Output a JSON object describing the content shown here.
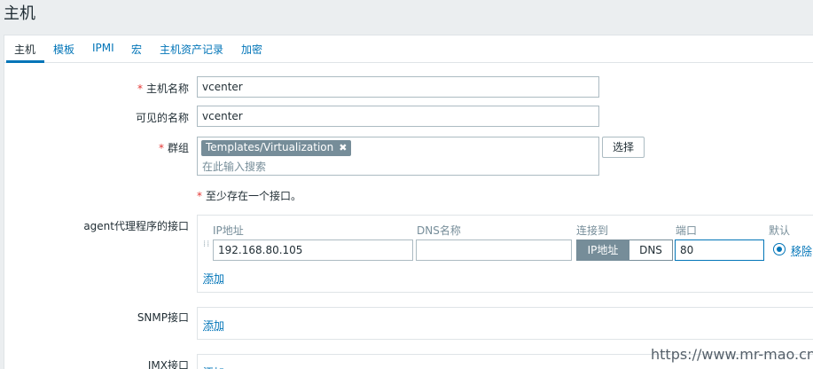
{
  "header": {
    "title": "主机"
  },
  "tabs": [
    {
      "label": "主机"
    },
    {
      "label": "模板"
    },
    {
      "label": "IPMI"
    },
    {
      "label": "宏"
    },
    {
      "label": "主机资产记录"
    },
    {
      "label": "加密"
    }
  ],
  "form": {
    "required_mark": "*",
    "host_name": {
      "label": "主机名称",
      "value": "vcenter"
    },
    "visible_name": {
      "label": "可见的名称",
      "value": "vcenter"
    },
    "groups": {
      "label": "群组",
      "chip": "Templates/Virtualization",
      "chip_close": "✖",
      "placeholder": "在此输入搜索",
      "select_button": "选择"
    },
    "interface_note": "至少存在一个接口。",
    "agent": {
      "label": "agent代理程序的接口",
      "headers": {
        "ip": "IP地址",
        "dns": "DNS名称",
        "connect": "连接到",
        "port": "端口",
        "default": "默认"
      },
      "ip_value": "192.168.80.105",
      "dns_value": "",
      "connect_ip": "IP地址",
      "connect_dns": "DNS",
      "port_value": "80",
      "remove": "移除",
      "add": "添加"
    },
    "snmp": {
      "label": "SNMP接口",
      "add": "添加"
    },
    "jmx": {
      "label": "JMX接口",
      "add": "添加"
    }
  },
  "watermark": "https://www.mr-mao.cn",
  "colors": {
    "accent": "#0275b8",
    "required": "#e33734",
    "chip_bg": "#768d99",
    "bg": "#ebeef0"
  }
}
